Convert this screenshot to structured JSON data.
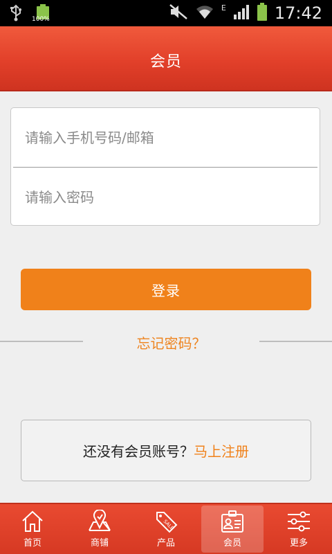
{
  "status_bar": {
    "battery_percent_label": "100%",
    "network_type": "E",
    "time": "17:42",
    "icons": [
      "usb-icon",
      "battery-icon",
      "mute-icon",
      "wifi-icon",
      "signal-icon",
      "battery-icon"
    ]
  },
  "header": {
    "title": "会员"
  },
  "login": {
    "phone_placeholder": "请输入手机号码/邮箱",
    "password_placeholder": "请输入密码",
    "login_label": "登录",
    "forgot_label": "忘记密码？"
  },
  "register": {
    "question": "还没有会员账号？",
    "link": "马上注册"
  },
  "tabs": [
    {
      "label": "首页",
      "icon": "home-icon",
      "active": false
    },
    {
      "label": "商铺",
      "icon": "map-pin-icon",
      "active": false
    },
    {
      "label": "产品",
      "icon": "sale-tag-icon",
      "active": false
    },
    {
      "label": "会员",
      "icon": "member-card-icon",
      "active": true
    },
    {
      "label": "更多",
      "icon": "sliders-icon",
      "active": false
    }
  ],
  "colors": {
    "header": "#e2402a",
    "accent_orange": "#f0811a",
    "tab_bar": "#e94a31"
  }
}
